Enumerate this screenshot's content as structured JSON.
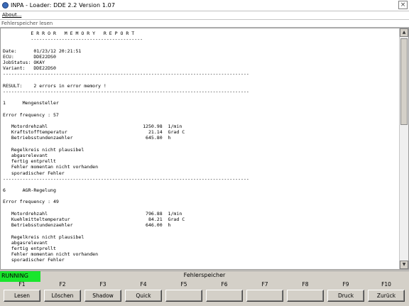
{
  "window": {
    "title": "INPA - Loader:  DDE 2.2 Version 1.07",
    "close_glyph": "×"
  },
  "menu": {
    "about": "About..."
  },
  "header": {
    "text": "Fehlerspeicher lesen"
  },
  "report_lines": [
    "          E R R O R   M E M O R Y   R E P O R T",
    "          ----------------------------------------",
    "",
    "Date:      01/23/12 20:21:51",
    "ECU:       DDE22DS0",
    "JobStatus: OKAY",
    "Variant:   DDE22DS0",
    "----------------------------------------------------------------------------------------",
    "",
    "RESULT:    2 errors in error memory !",
    "----------------------------------------------------------------------------------------",
    "",
    "1      Mengensteller",
    "",
    "Error frequency : 57",
    "",
    "   Motordrehzahl                                  1250.98  1/min",
    "   Kraftstofftemperatur                             21.14  Grad C",
    "   Betriebsstundenzaehler                          645.80  h",
    "",
    "   Regelkreis nicht plausibel",
    "   abgasrelevant",
    "   fertig entprellt",
    "   Fehler momentan nicht vorhanden",
    "   sporadischer Fehler",
    "----------------------------------------------------------------------------------------",
    "",
    "6      AGR-Regelung",
    "",
    "Error frequency : 49",
    "",
    "   Motordrehzahl                                   796.88  1/min",
    "   Kuehlmitteltemperatur                            84.21  Grad C",
    "   Betriebsstundenzaehler                          646.00  h",
    "",
    "   Regelkreis nicht plausibel",
    "   abgasrelevant",
    "   fertig entprellt",
    "   Fehler momentan nicht vorhanden",
    "   sporadischer Fehler"
  ],
  "scrollbar": {
    "up": "▲",
    "down": "▼"
  },
  "status": {
    "state": "RUNNING",
    "state_color": "#19e62c",
    "title": "Fehlerspeicher"
  },
  "function_keys": [
    {
      "key": "F1",
      "label": "Lesen"
    },
    {
      "key": "F2",
      "label": "Löschen"
    },
    {
      "key": "F3",
      "label": "Shadow"
    },
    {
      "key": "F4",
      "label": "Quick"
    },
    {
      "key": "F5",
      "label": ""
    },
    {
      "key": "F6",
      "label": ""
    },
    {
      "key": "F7",
      "label": ""
    },
    {
      "key": "F8",
      "label": ""
    },
    {
      "key": "F9",
      "label": "Druck"
    },
    {
      "key": "F10",
      "label": "Zurück"
    }
  ]
}
